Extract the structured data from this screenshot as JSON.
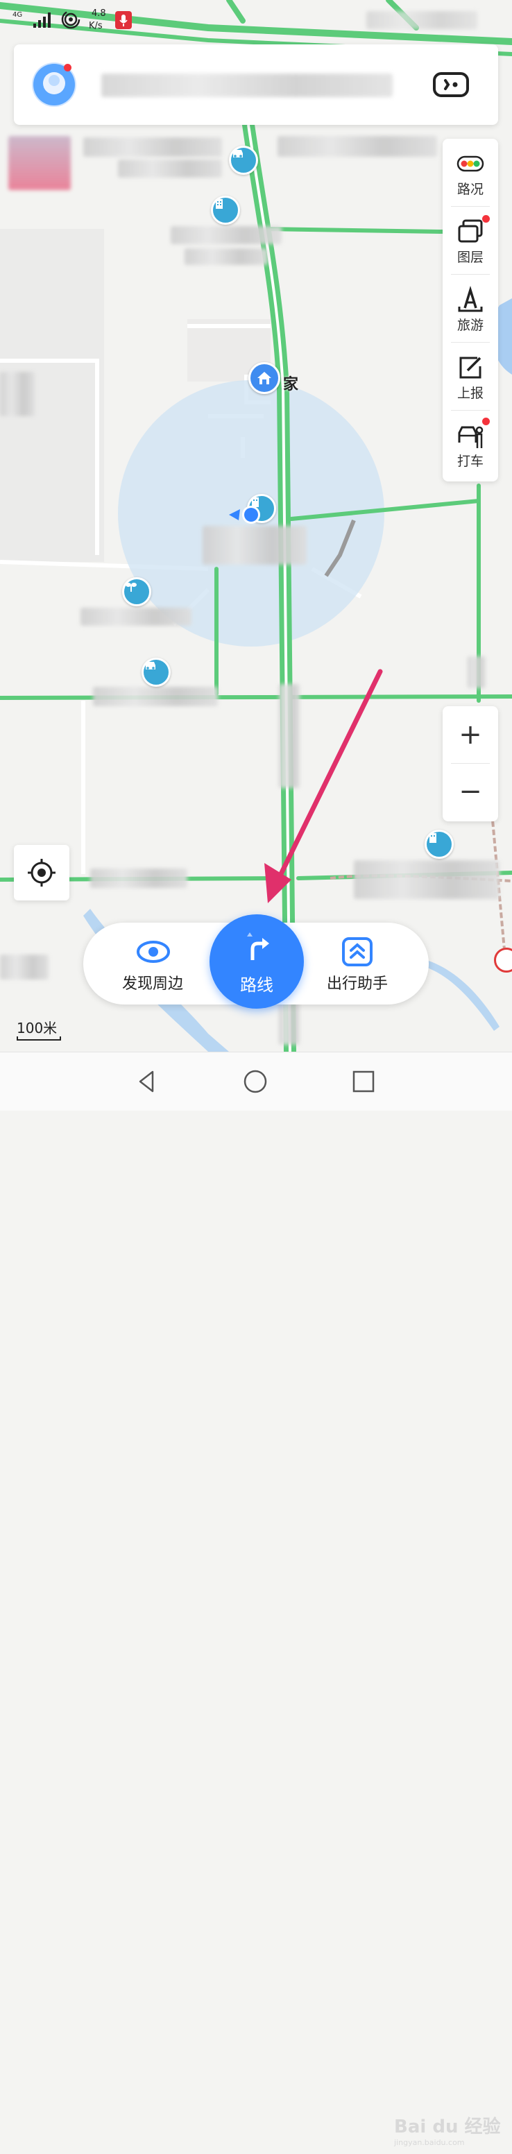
{
  "status_bar": {
    "network": "4G",
    "speed_value": "4.8",
    "speed_unit": "K/s"
  },
  "search": {
    "avatar_icon": "user-avatar-icon",
    "placeholder_blurred": true,
    "right_icon": "card-icon"
  },
  "map": {
    "home_label": "家",
    "scale_label": "100米"
  },
  "side_toolbar": {
    "items": [
      {
        "label": "路况",
        "icon": "traffic-light-icon",
        "badge": false
      },
      {
        "label": "图层",
        "icon": "layers-icon",
        "badge": true
      },
      {
        "label": "旅游",
        "icon": "travel-icon",
        "badge": false
      },
      {
        "label": "上报",
        "icon": "report-icon",
        "badge": false
      },
      {
        "label": "打车",
        "icon": "taxi-icon",
        "badge": true
      }
    ]
  },
  "zoom": {
    "in_label": "+",
    "out_label": "−"
  },
  "bottom_bar": {
    "discover_label": "发现周边",
    "route_label": "路线",
    "assistant_label": "出行助手"
  },
  "watermark": {
    "text": "Bai du 经验",
    "subtext": "jingyan.baidu.com"
  },
  "colors": {
    "accent": "#3385ff",
    "road_green": "#5ccb7a",
    "badge_red": "#f4333c",
    "annotation_arrow": "#e0306b"
  }
}
